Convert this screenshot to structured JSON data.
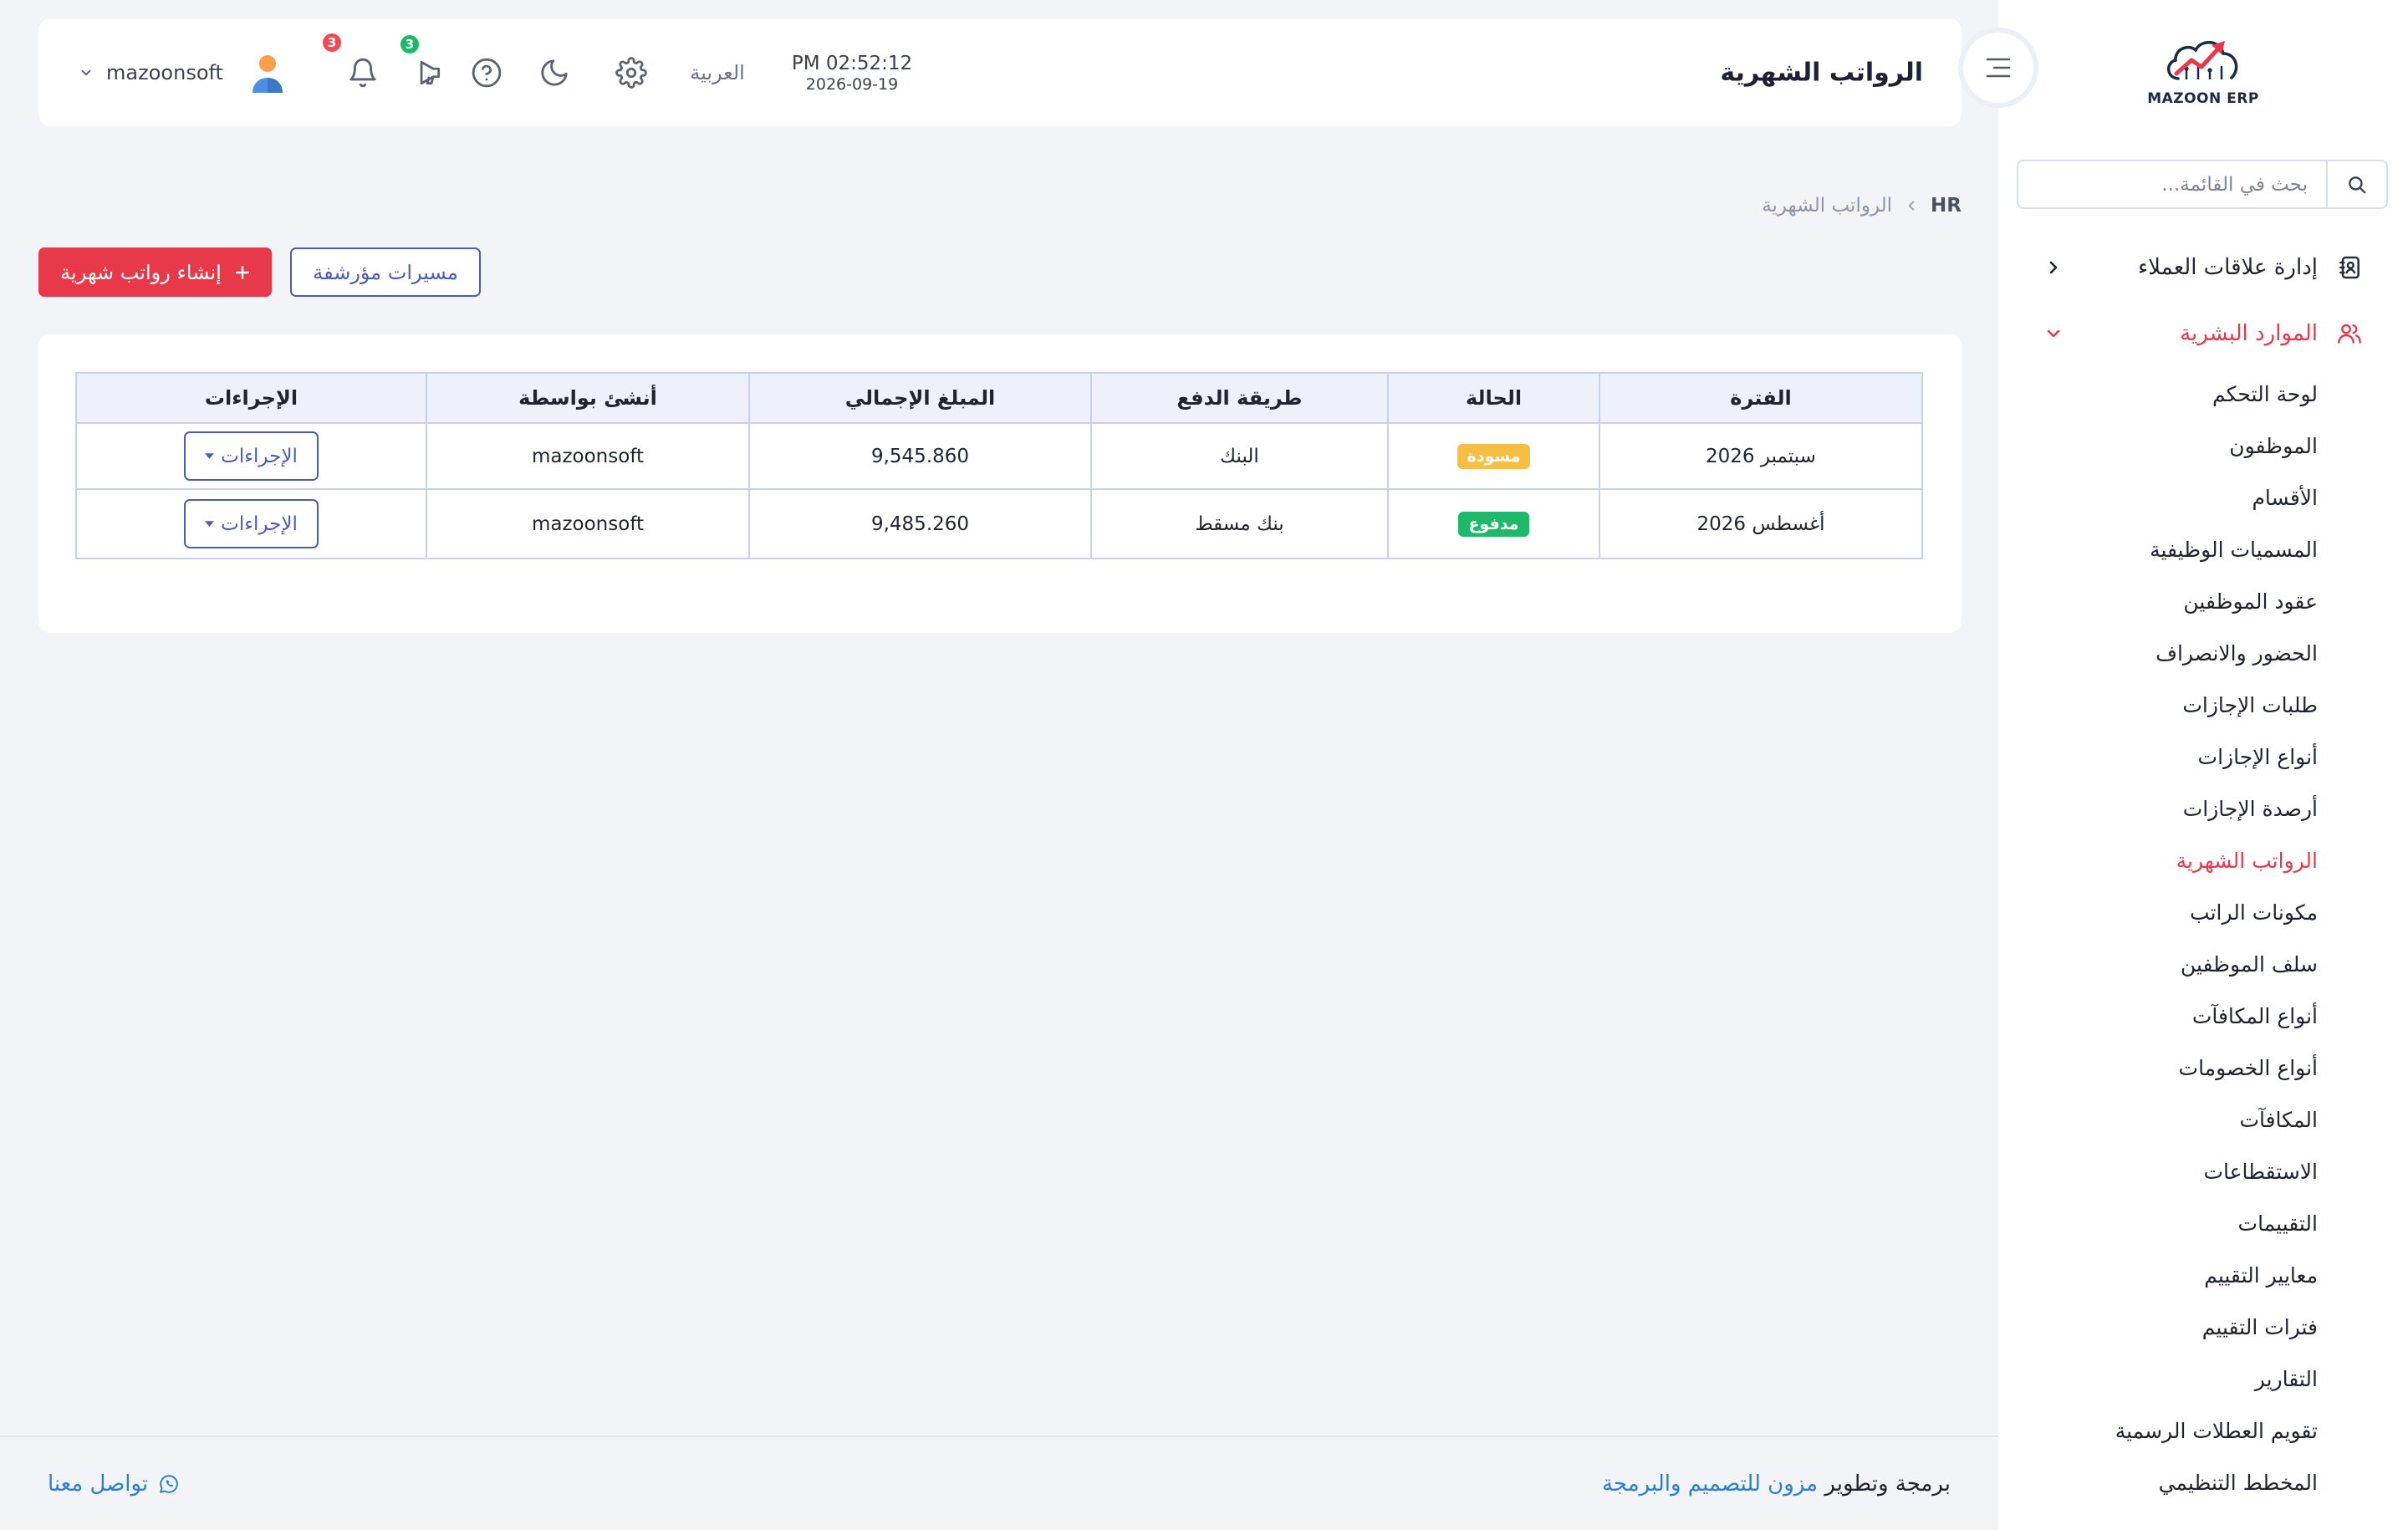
{
  "colors": {
    "accent": "#e8394a",
    "primary": "#4a5cb8",
    "link": "#2a7fd1",
    "badge_draft": "#f6bf43",
    "badge_paid": "#1db868",
    "badge_bell": "#ef4b55",
    "badge_announcements": "#1db868",
    "page_bg": "#f2f4f7",
    "table_header_bg": "#eef0fb",
    "table_border": "#c9d1ea"
  },
  "sidebar": {
    "logo": {
      "text": "MAZOON ERP"
    },
    "search": {
      "placeholder": "بحث في القائمة...",
      "icon": "search-icon"
    },
    "menu": [
      {
        "label": "إدارة علاقات العملاء",
        "icon": "contacts-book-icon",
        "chevron": "chevron-right-icon",
        "expanded": false
      },
      {
        "label": "الموارد البشرية",
        "icon": "users-icon",
        "chevron": "chevron-down-icon",
        "expanded": true,
        "items": [
          "لوحة التحكم",
          "الموظفون",
          "الأقسام",
          "المسميات الوظيفية",
          "عقود الموظفين",
          "الحضور والانصراف",
          "طلبات الإجازات",
          "أنواع الإجازات",
          "أرصدة الإجازات",
          "الرواتب الشهرية",
          "مكونات الراتب",
          "سلف الموظفين",
          "أنواع المكافآت",
          "أنواع الخصومات",
          "المكافآت",
          "الاستقطاعات",
          "التقييمات",
          "معايير التقييم",
          "فترات التقييم",
          "التقارير",
          "تقويم العطلات الرسمية",
          "المخطط التنظيمي"
        ]
      }
    ]
  },
  "header": {
    "toggle_icon": "menu-toggle-icon",
    "title": "الرواتب الشهرية",
    "clock": {
      "time": "PM 02:52:12",
      "date": "2026-09-19"
    },
    "language": "العربية",
    "icons": [
      "gear-icon",
      "moon-icon",
      "help-icon",
      "megaphone-icon",
      "bell-icon"
    ],
    "announcements_badge": "3",
    "notifications_badge": "3",
    "user": {
      "name": "mazoonsoft",
      "avatar": "user-avatar-icon"
    }
  },
  "breadcrumb": {
    "root": "HR",
    "current": "الرواتب الشهرية"
  },
  "toolbar": {
    "create_label": "إنشاء رواتب شهرية",
    "create_icon": "plus-icon",
    "archived_label": "مسيرات مؤرشفة"
  },
  "table": {
    "columns": [
      "الفترة",
      "الحالة",
      "طريقة الدفع",
      "المبلغ الإجمالي",
      "أنشئ بواسطة",
      "الإجراءات"
    ],
    "rows": [
      {
        "period": "سبتمبر 2026",
        "status": "مسودة",
        "payment_method": "البنك",
        "total": "9,545.860",
        "created_by": "mazoonsoft",
        "actions_label": "الإجراءات"
      },
      {
        "period": "أغسطس 2026",
        "status": "مدفوع",
        "payment_method": "بنك مسقط",
        "total": "9,485.260",
        "created_by": "mazoonsoft",
        "actions_label": "الإجراءات"
      }
    ]
  },
  "footer": {
    "credit_prefix": "برمجة وتطوير",
    "credit_link": "مزون للتصميم والبرمجة",
    "contact_label": "تواصل معنا",
    "contact_icon": "whatsapp-icon"
  }
}
